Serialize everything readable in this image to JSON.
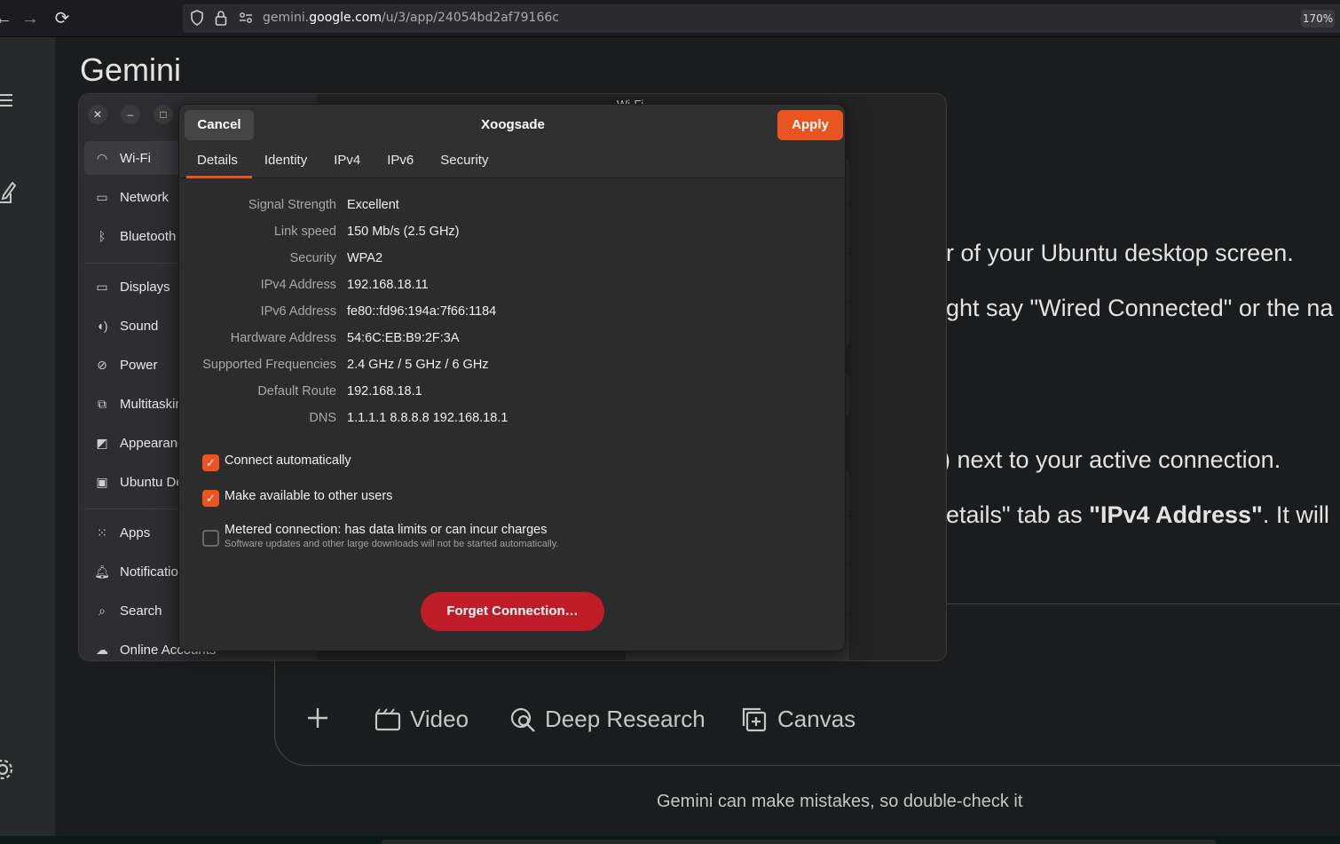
{
  "browser": {
    "url_prefix": "gemini.",
    "url_host": "google.com",
    "url_path": "/u/3/app/24054bd2af79166c",
    "zoom": "170%"
  },
  "gemini": {
    "title": "Gemini",
    "chat_lines": [
      "r of your Ubuntu desktop screen.",
      "ght say \"Wired Connected\" or the na",
      ") next to your active connection.",
      "etails\" tab as "
    ],
    "ipv4_bold": "\"IPv4 Address\"",
    "chat_line4_tail": ". It will",
    "tools": [
      "Video",
      "Deep Research",
      "Canvas"
    ],
    "disclaimer": "Gemini can make mistakes, so double-check it"
  },
  "settings": {
    "header_partial": "Wi-Fi",
    "sidebar_group1": [
      {
        "label": "Wi-Fi",
        "icon": "wifi-icon"
      },
      {
        "label": "Network",
        "icon": "network-icon"
      },
      {
        "label": "Bluetooth",
        "icon": "bluetooth-icon"
      }
    ],
    "sidebar_group2": [
      {
        "label": "Displays",
        "icon": "display-icon"
      },
      {
        "label": "Sound",
        "icon": "sound-icon"
      },
      {
        "label": "Power",
        "icon": "power-icon"
      },
      {
        "label": "Multitasking",
        "icon": "multitasking-icon"
      },
      {
        "label": "Appearance",
        "icon": "appearance-icon"
      },
      {
        "label": "Ubuntu Desktop",
        "icon": "ubuntu-desktop-icon"
      }
    ],
    "sidebar_group3": [
      {
        "label": "Apps",
        "icon": "apps-icon"
      },
      {
        "label": "Notifications",
        "icon": "bell-icon"
      },
      {
        "label": "Search",
        "icon": "search-icon"
      },
      {
        "label": "Online Accounts",
        "icon": "cloud-icon"
      }
    ]
  },
  "dialog": {
    "title": "Xoogsade",
    "cancel_label": "Cancel",
    "apply_label": "Apply",
    "tabs": [
      "Details",
      "Identity",
      "IPv4",
      "IPv6",
      "Security"
    ],
    "active_tab": "Details",
    "details": [
      {
        "label": "Signal Strength",
        "value": "Excellent"
      },
      {
        "label": "Link speed",
        "value": "150 Mb/s (2.5 GHz)"
      },
      {
        "label": "Security",
        "value": "WPA2"
      },
      {
        "label": "IPv4 Address",
        "value": "192.168.18.11"
      },
      {
        "label": "IPv6 Address",
        "value": "fe80::fd96:194a:7f66:1184"
      },
      {
        "label": "Hardware Address",
        "value": "54:6C:EB:B9:2F:3A"
      },
      {
        "label": "Supported Frequencies",
        "value": "2.4 GHz / 5 GHz / 6 GHz"
      },
      {
        "label": "Default Route",
        "value": "192.168.18.1"
      },
      {
        "label": "DNS",
        "value": "1.1.1.1 8.8.8.8 192.168.18.1"
      }
    ],
    "connect_automatically": {
      "label": "Connect automatically",
      "checked": true
    },
    "available_to_others": {
      "label": "Make available to other users",
      "checked": true
    },
    "metered": {
      "label": "Metered connection: has data limits or can incur charges",
      "sub": "Software updates and other large downloads will not be started automatically.",
      "checked": false
    },
    "forget_label": "Forget Connection…"
  },
  "colors": {
    "accent": "#e95420",
    "destructive": "#c01c28"
  }
}
